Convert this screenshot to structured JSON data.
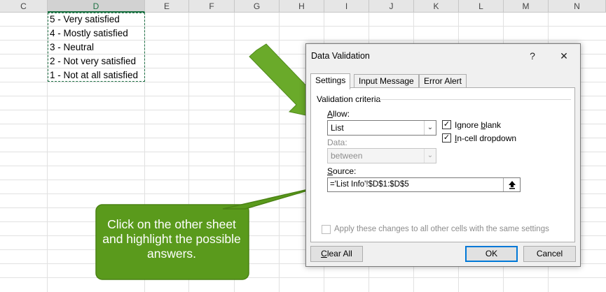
{
  "sheet": {
    "columns": [
      "C",
      "D",
      "E",
      "F",
      "G",
      "H",
      "I",
      "J",
      "K",
      "L",
      "M",
      "N"
    ],
    "selected_column": "D",
    "cells": [
      "5 - Very satisfied",
      "4 - Mostly satisfied",
      "3 - Neutral",
      "2 - Not very satisfied",
      "1 - Not at all satisfied"
    ]
  },
  "callout": {
    "text": "Click on the other sheet and highlight the possible answers.",
    "fill_color": "#5a9a1c",
    "arrow_color": "#6aaa2a"
  },
  "dialog": {
    "title": "Data Validation",
    "help_label": "?",
    "close_label": "✕",
    "tabs": [
      "Settings",
      "Input Message",
      "Error Alert"
    ],
    "active_tab": "Settings",
    "section_title": "Validation criteria",
    "allow": {
      "label_underlined": "A",
      "label_rest": "llow:",
      "value": "List"
    },
    "data": {
      "label": "Data:",
      "value": "between"
    },
    "ignore_blank": {
      "label_underlined": "b",
      "label_pre": "Ignore ",
      "label_post": "lank",
      "checked": true
    },
    "in_cell_dropdown": {
      "label_underlined": "I",
      "label_rest": "n-cell dropdown",
      "checked": true
    },
    "source": {
      "label_underlined": "S",
      "label_rest": "ource:",
      "value": "='List Info'!$D$1:$D$5"
    },
    "apply_all": {
      "label": "Apply these changes to all other cells with the same settings",
      "checked": false
    },
    "buttons": {
      "clear_all_underlined": "C",
      "clear_all_rest": "lear All",
      "ok": "OK",
      "cancel": "Cancel"
    }
  }
}
